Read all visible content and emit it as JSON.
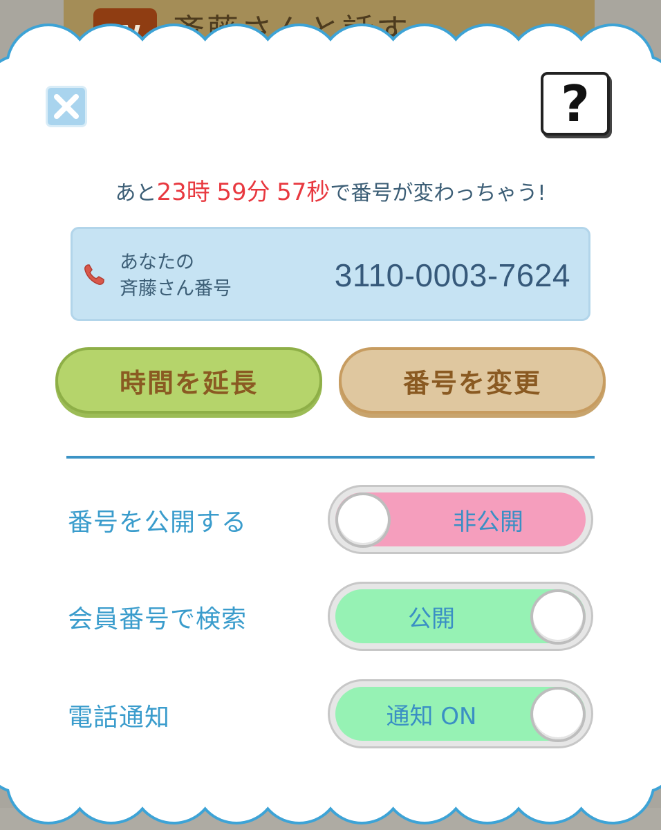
{
  "background": {
    "header_title": "斉藤さんと話す",
    "logo_letter": "W"
  },
  "dialog": {
    "countdown": {
      "prefix": "あと",
      "hours": "23",
      "hour_unit": "時",
      "minutes": "59",
      "minute_unit": "分",
      "seconds": "57",
      "second_unit": "秒",
      "suffix": "で番号が変わっちゃう!"
    },
    "number_box": {
      "label_line1": "あなたの",
      "label_line2": "斉藤さん番号",
      "value": "3110-0003-7624"
    },
    "buttons": {
      "extend": "時間を延長",
      "change": "番号を変更"
    },
    "help_label": "?",
    "settings": [
      {
        "label": "番号を公開する",
        "state": "非公開",
        "on": false
      },
      {
        "label": "会員番号で検索",
        "state": "公開",
        "on": true
      },
      {
        "label": "電話通知",
        "state": "通知 ON",
        "on": true
      }
    ]
  },
  "colors": {
    "accent_blue": "#3a9ccc",
    "countdown_red": "#e8383f",
    "toggle_off": "#f59ebd",
    "toggle_on": "#96f2b4"
  }
}
